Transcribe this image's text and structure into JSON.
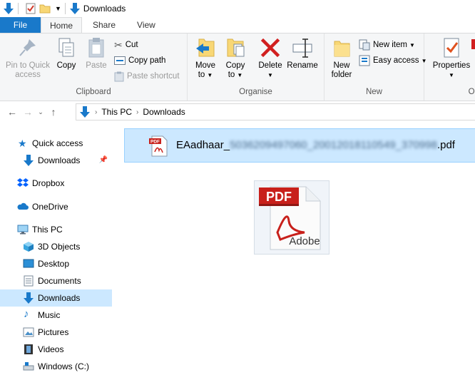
{
  "window": {
    "title": "Downloads"
  },
  "ribbon_tabs": [
    {
      "label": "File"
    },
    {
      "label": "Home"
    },
    {
      "label": "Share"
    },
    {
      "label": "View"
    }
  ],
  "clipboard": {
    "pin_label_1": "Pin to Quick",
    "pin_label_2": "access",
    "copy": "Copy",
    "paste": "Paste",
    "cut": "Cut",
    "copy_path": "Copy path",
    "paste_shortcut": "Paste shortcut",
    "group_label": "Clipboard"
  },
  "organise": {
    "move_1": "Move",
    "move_2": "to",
    "copy_1": "Copy",
    "copy_2": "to",
    "delete": "Delete",
    "rename": "Rename",
    "group_label": "Organise"
  },
  "new": {
    "new_folder_1": "New",
    "new_folder_2": "folder",
    "new_item": "New item",
    "easy_access": "Easy access",
    "group_label": "New"
  },
  "open": {
    "properties": "Properties",
    "group_label": "Op"
  },
  "address": {
    "crumbs": [
      "This PC",
      "Downloads"
    ]
  },
  "navpane": {
    "quick_access": "Quick access",
    "downloads_pinned": "Downloads",
    "dropbox": "Dropbox",
    "onedrive": "OneDrive",
    "this_pc": "This PC",
    "objects3d": "3D Objects",
    "desktop": "Desktop",
    "documents": "Documents",
    "downloads": "Downloads",
    "music": "Music",
    "pictures": "Pictures",
    "videos": "Videos",
    "windows_c": "Windows (C:)"
  },
  "files": [
    {
      "name_prefix": "EAadhaar_",
      "name_redacted": "5036209497060_20012018110549_370998",
      "name_suffix": ".pdf"
    }
  ],
  "preview": {
    "badge": "PDF",
    "brand": "Adobe"
  },
  "colors": {
    "accent": "#1979ca",
    "selection": "#cce8ff",
    "selection_border": "#99d1ff"
  }
}
